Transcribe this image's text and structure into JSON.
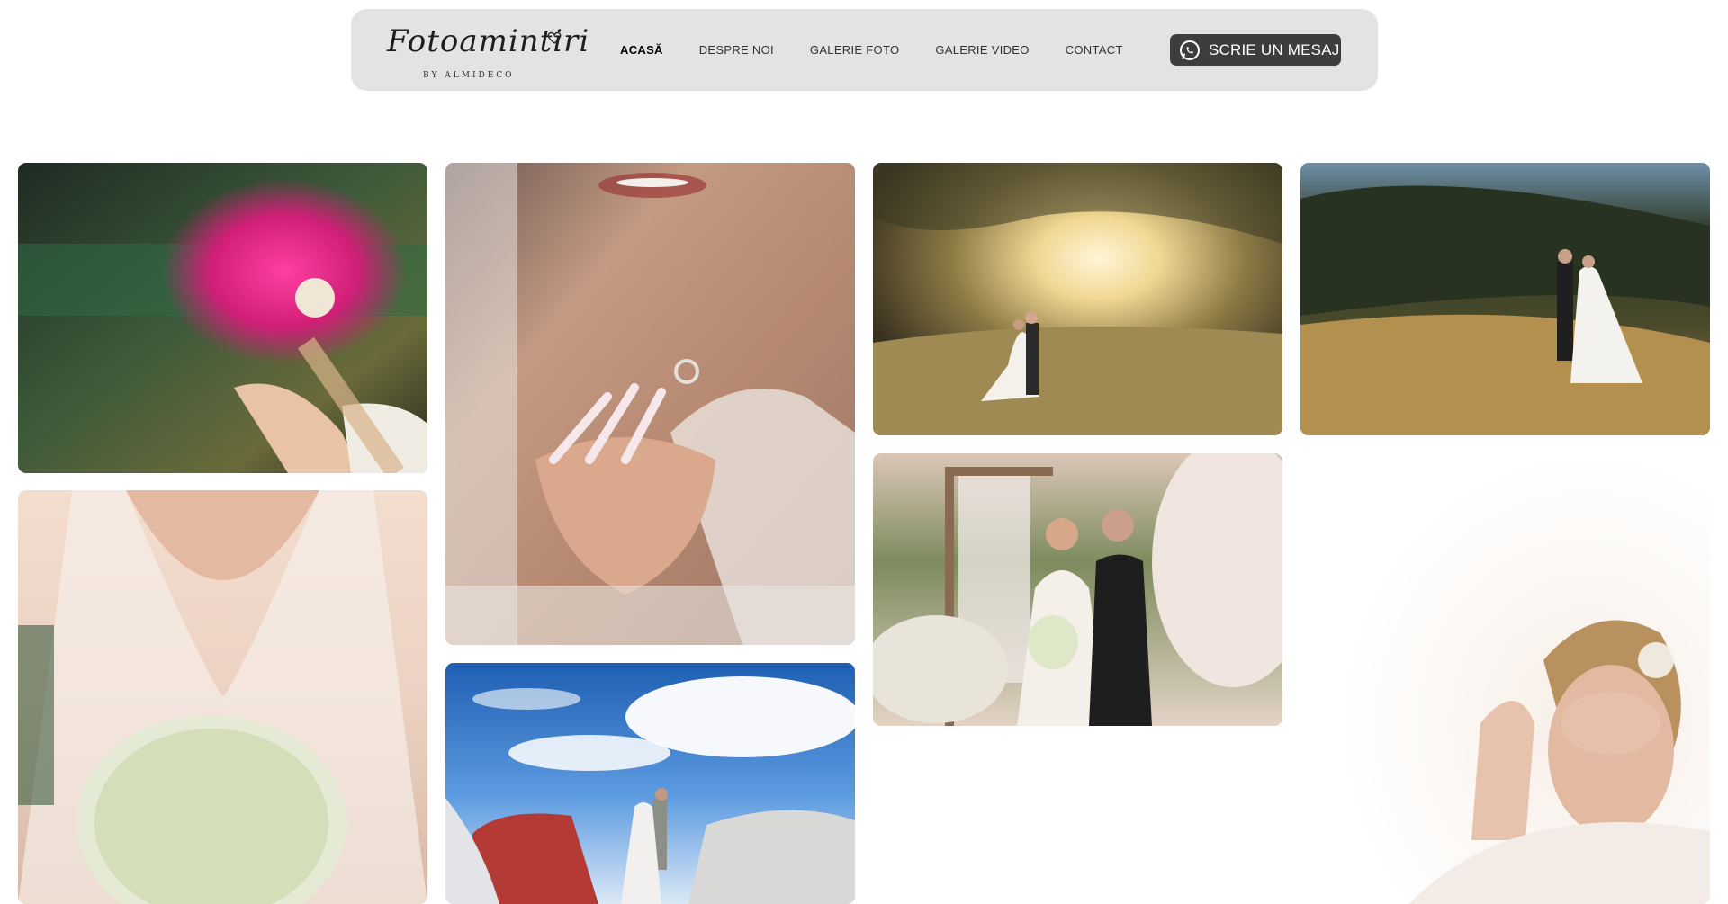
{
  "header": {
    "logo": {
      "script_text": "Fotoamintiri",
      "sub_text": "BY ALMIDECO"
    },
    "nav": [
      {
        "label": "ACASĂ",
        "active": true
      },
      {
        "label": "DESPRE NOI",
        "active": false
      },
      {
        "label": "GALERIE FOTO",
        "active": false
      },
      {
        "label": "GALERIE VIDEO",
        "active": false
      },
      {
        "label": "CONTACT",
        "active": false
      }
    ],
    "cta": {
      "label": "SCRIE UN MESAJ",
      "icon": "whatsapp-icon"
    }
  },
  "gallery": {
    "photos": [
      {
        "name": "bouquet-pink-photo"
      },
      {
        "name": "bride-ring-hands-photo"
      },
      {
        "name": "couple-sunlight-field-photo"
      },
      {
        "name": "couple-meadow-forest-photo"
      },
      {
        "name": "bride-dress-lily-bouquet-photo"
      },
      {
        "name": "couple-cars-sky-photo"
      },
      {
        "name": "couple-floral-arch-kiss-photo"
      },
      {
        "name": "bride-portrait-white-photo"
      }
    ]
  },
  "colors": {
    "header_bg": "#e3e3e3",
    "cta_bg": "#3d3d3d",
    "page_bg": "#ffffff"
  }
}
